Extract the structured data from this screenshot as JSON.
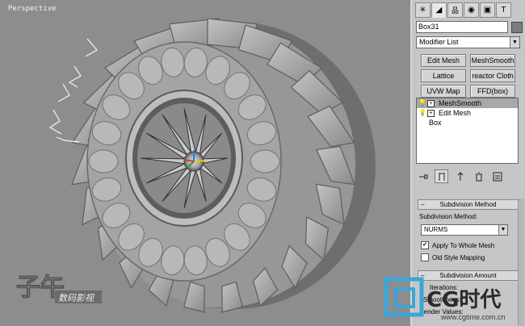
{
  "viewport": {
    "label": "Perspective"
  },
  "command_panel": {
    "tabs": [
      {
        "name": "create-tab",
        "icon": "create-icon"
      },
      {
        "name": "modify-tab",
        "icon": "modify-icon"
      },
      {
        "name": "hierarchy-tab",
        "icon": "hierarchy-icon"
      },
      {
        "name": "motion-tab",
        "icon": "motion-icon"
      },
      {
        "name": "display-tab",
        "icon": "display-icon"
      },
      {
        "name": "utilities-tab",
        "icon": "utilities-icon"
      }
    ],
    "object_name": "Box31",
    "object_color": "#7d7d7d",
    "modifier_list": "Modifier List",
    "modifier_buttons": [
      "Edit Mesh",
      "MeshSmooth",
      "Lattice",
      "reactor Cloth",
      "UVW Map",
      "FFD(box)"
    ],
    "stack": [
      {
        "label": "MeshSmooth",
        "selected": true
      },
      {
        "label": "Edit Mesh",
        "selected": false
      },
      {
        "label": "Box",
        "selected": false
      }
    ],
    "subdivision_method": {
      "rollout_title": "Subdivision Method",
      "label": "Subdivision Method:",
      "value": "NURMS",
      "apply_whole_mesh_label": "Apply To Whole Mesh",
      "apply_whole_mesh_checked": true,
      "old_style_label": "Old Style Mapping",
      "old_style_checked": false
    },
    "subdivision_amount": {
      "rollout_title": "Subdivision Amount",
      "iterations_label": "Iterations:",
      "smoothness_label": "Smoothness:",
      "render_values_label": "Render Values:"
    }
  },
  "watermarks": {
    "left_brand": "子午",
    "left_sub": "数码影视",
    "right_brand": "CG时代",
    "right_url": "www.cgtime.com.cn"
  },
  "colors": {
    "viewport_bg": "#8d8d8d",
    "panel_bg": "#c6c6c6",
    "selection": "#a8a8a8"
  }
}
